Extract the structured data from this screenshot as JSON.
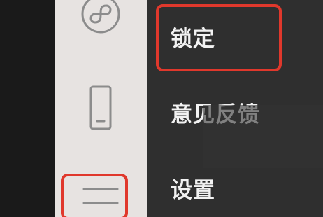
{
  "sidebar": {
    "icons": [
      {
        "name": "mini-program-icon"
      },
      {
        "name": "phone-icon"
      },
      {
        "name": "menu-icon"
      }
    ]
  },
  "menu": {
    "items": [
      {
        "label": "锁定"
      },
      {
        "label": "意见反馈"
      },
      {
        "label": "设置"
      }
    ]
  },
  "colors": {
    "highlight": "#e0382c",
    "menu_background": "#2f2f2f",
    "sidebar_background": "#e7e3e1",
    "icon_stroke": "#8c8c8c"
  }
}
